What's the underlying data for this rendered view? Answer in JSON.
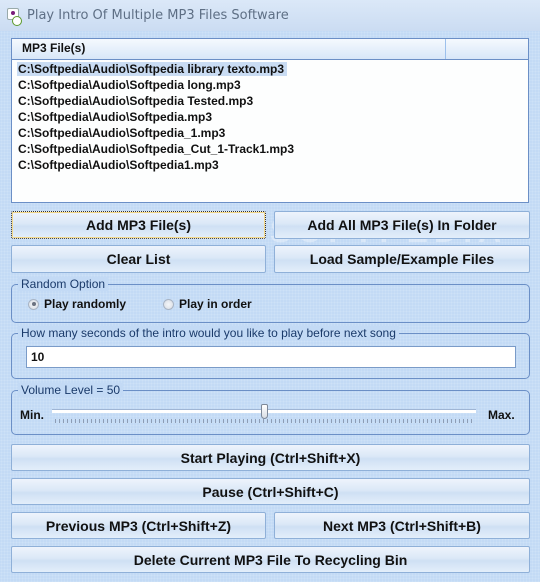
{
  "window": {
    "title": "Play Intro Of Multiple MP3 Files Software",
    "icon": "app-icon"
  },
  "file_list": {
    "column_header": "MP3 File(s)",
    "items": [
      "C:\\Softpedia\\Audio\\Softpedia library texto.mp3",
      "C:\\Softpedia\\Audio\\Softpedia long.mp3",
      "C:\\Softpedia\\Audio\\Softpedia Tested.mp3",
      "C:\\Softpedia\\Audio\\Softpedia.mp3",
      "C:\\Softpedia\\Audio\\Softpedia_1.mp3",
      "C:\\Softpedia\\Audio\\Softpedia_Cut_1-Track1.mp3",
      "C:\\Softpedia\\Audio\\Softpedia1.mp3"
    ],
    "selected_index": 0
  },
  "buttons": {
    "add_files": "Add MP3 File(s)",
    "add_folder": "Add All MP3 File(s) In Folder",
    "clear_list": "Clear List",
    "load_samples": "Load Sample/Example Files",
    "start_playing": "Start Playing (Ctrl+Shift+X)",
    "pause": "Pause (Ctrl+Shift+C)",
    "previous": "Previous MP3 (Ctrl+Shift+Z)",
    "next": "Next MP3 (Ctrl+Shift+B)",
    "delete_current": "Delete Current MP3 File To Recycling Bin"
  },
  "random_option": {
    "legend": "Random Option",
    "options": [
      {
        "label": "Play randomly",
        "checked": true
      },
      {
        "label": "Play in order",
        "checked": false
      }
    ]
  },
  "intro_seconds": {
    "legend": "How many seconds of the intro would you like to play before next song",
    "value": "10"
  },
  "volume": {
    "legend": "Volume Level = 50",
    "min_label": "Min.",
    "max_label": "Max.",
    "value": 50,
    "min": 0,
    "max": 100
  },
  "watermark": "SOFTPEDIA"
}
